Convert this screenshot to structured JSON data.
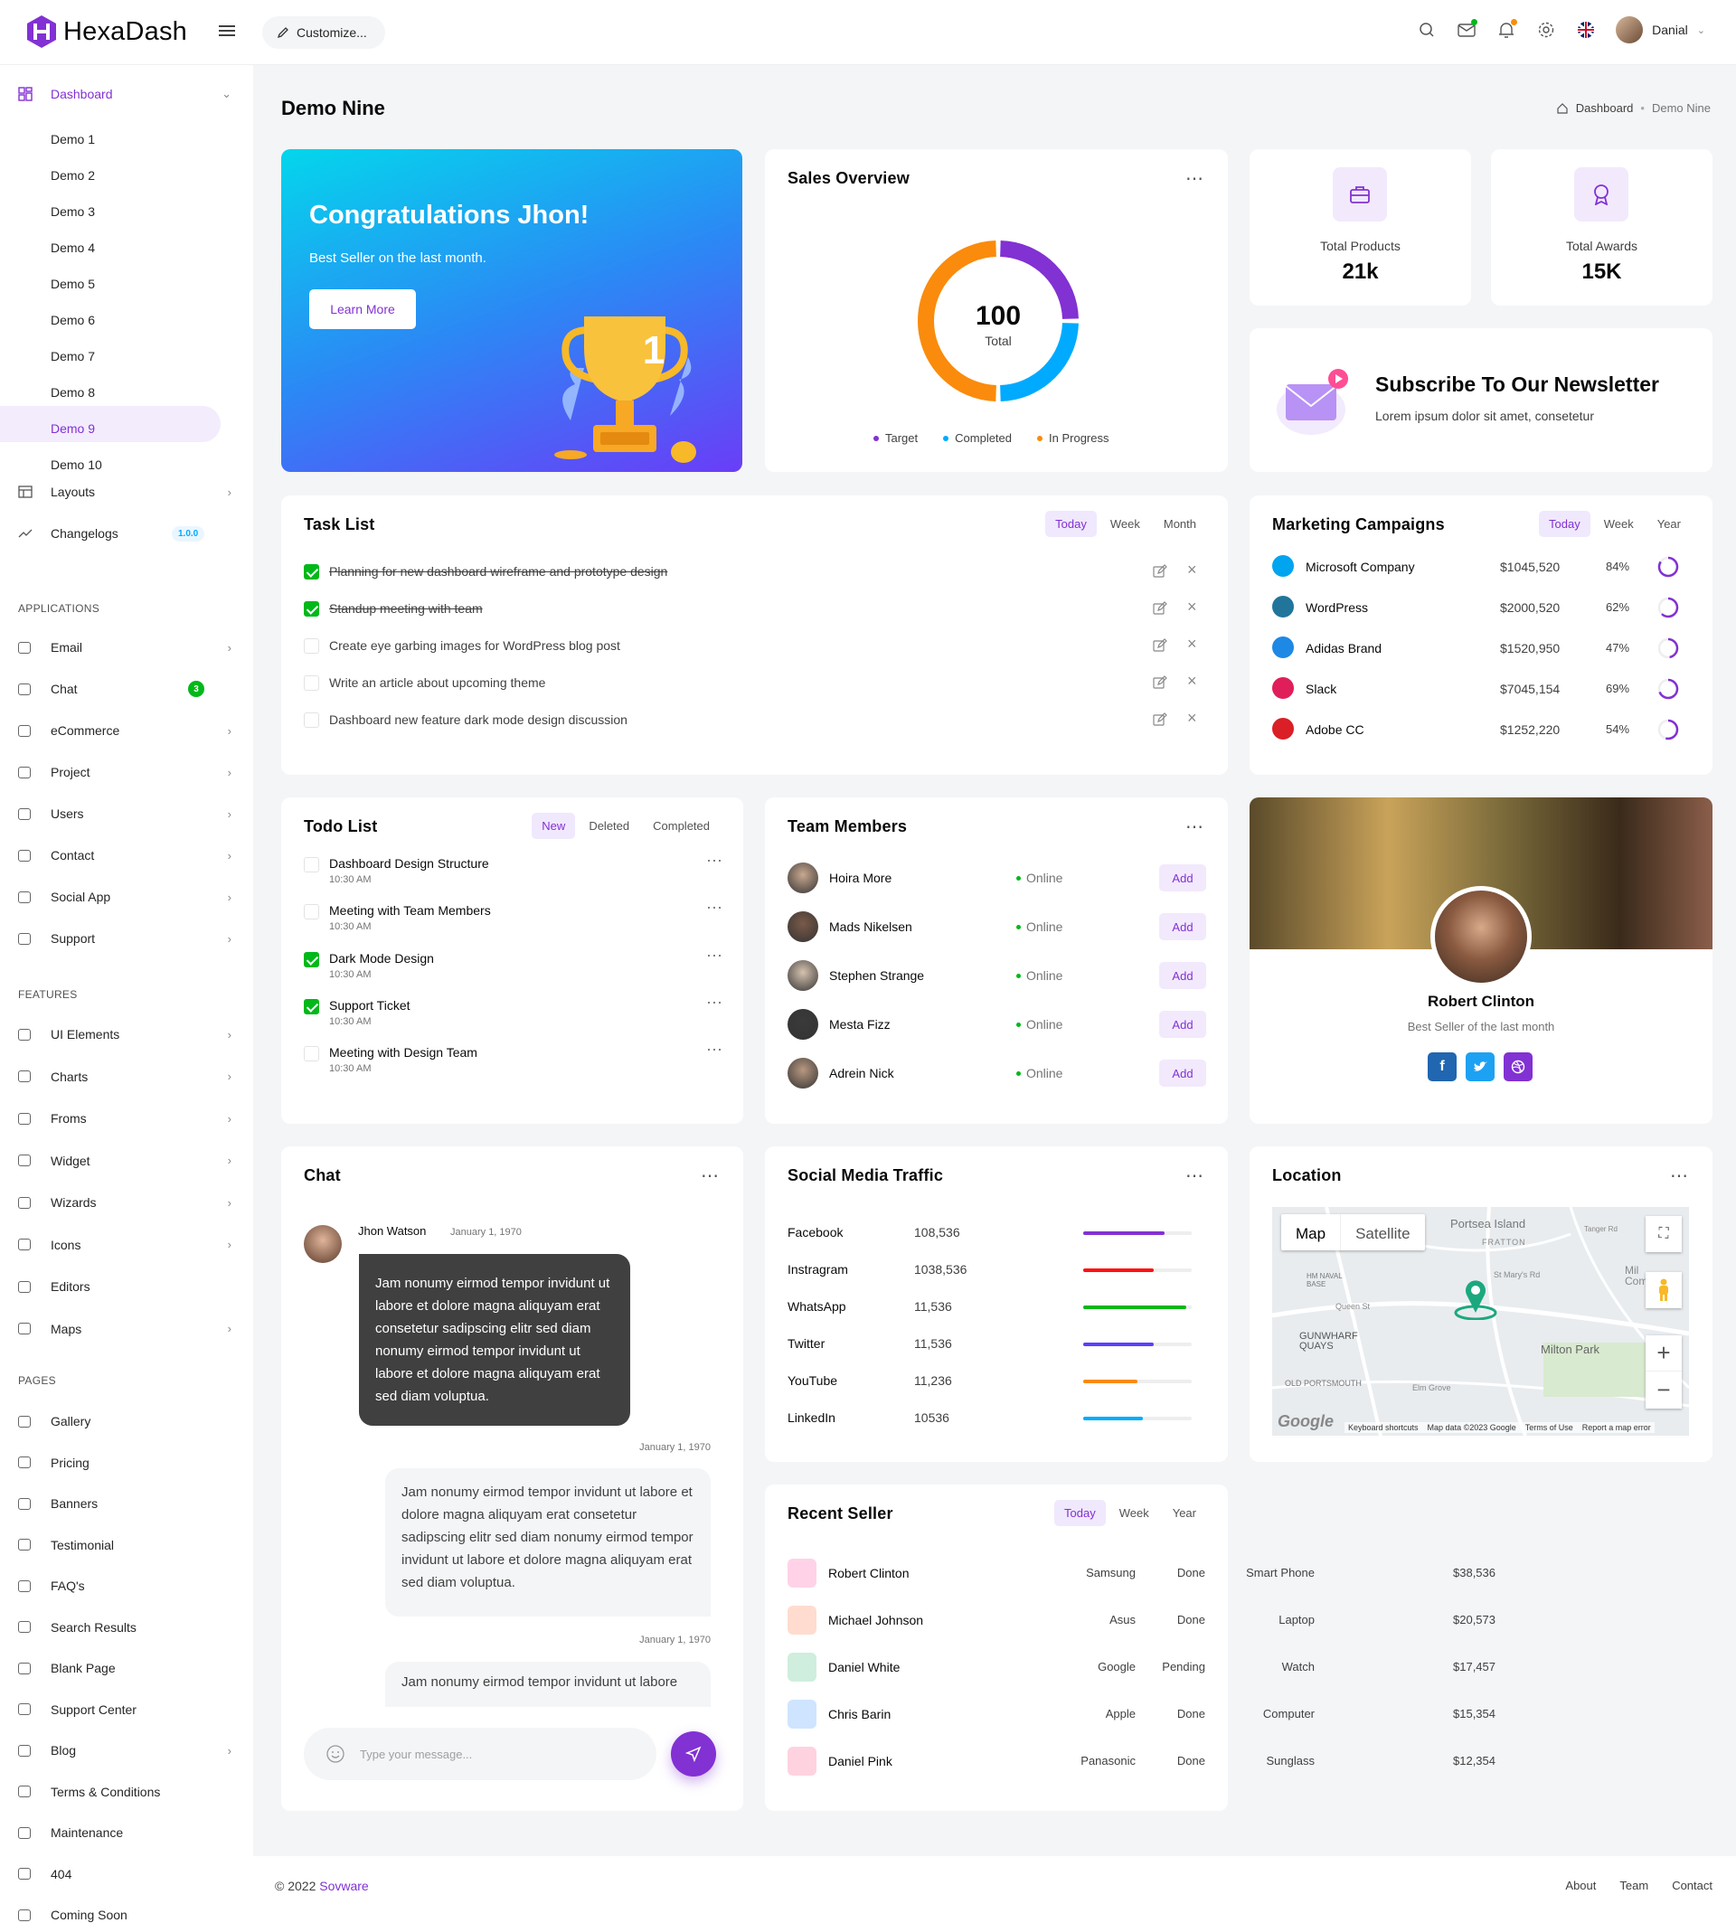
{
  "brand": {
    "name": "HexaDash"
  },
  "header": {
    "customize": "Customize...",
    "user_name": "Danial"
  },
  "sidebar": {
    "dashboard": "Dashboard",
    "demos": [
      "Demo 1",
      "Demo 2",
      "Demo 3",
      "Demo 4",
      "Demo 5",
      "Demo 6",
      "Demo 7",
      "Demo 8",
      "Demo 9",
      "Demo 10"
    ],
    "layouts": "Layouts",
    "changelogs": "Changelogs",
    "changelogs_badge": "1.0.0",
    "applications_title": "APPLICATIONS",
    "applications": [
      "Email",
      "Chat",
      "eCommerce",
      "Project",
      "Users",
      "Contact",
      "Social App",
      "Support"
    ],
    "chat_badge": "3",
    "features_title": "FEATURES",
    "features": [
      "UI Elements",
      "Charts",
      "Froms",
      "Widget",
      "Wizards",
      "Icons",
      "Editors",
      "Maps"
    ],
    "pages_title": "PAGES",
    "pages": [
      "Gallery",
      "Pricing",
      "Banners",
      "Testimonial",
      "FAQ's",
      "Search Results",
      "Blank Page",
      "Support Center",
      "Blog",
      "Terms & Conditions",
      "Maintenance",
      "404",
      "Coming Soon"
    ]
  },
  "page": {
    "title": "Demo Nine",
    "breadcrumb_home": "Dashboard",
    "breadcrumb_current": "Demo Nine"
  },
  "congrats": {
    "title": "Congratulations Jhon!",
    "subtitle": "Best Seller on the last month.",
    "button": "Learn More",
    "trophy_number": "1"
  },
  "sales_overview": {
    "title": "Sales Overview",
    "total_value": "100",
    "total_label": "Total",
    "legend": [
      "Target",
      "Completed",
      "In Progress"
    ]
  },
  "chart_data": {
    "type": "pie",
    "title": "Sales Overview",
    "categories": [
      "Target",
      "Completed",
      "In Progress"
    ],
    "values": [
      25,
      25,
      50
    ],
    "colors": [
      "#8231d3",
      "#00aaff",
      "#fa8b0c"
    ]
  },
  "stats": [
    {
      "label": "Total Products",
      "value": "21k"
    },
    {
      "label": "Total Awards",
      "value": "15K"
    }
  ],
  "newsletter": {
    "title": "Subscribe To Our Newsletter",
    "text": "Lorem ipsum dolor sit amet, consetetur"
  },
  "task_list": {
    "title": "Task List",
    "tabs": [
      "Today",
      "Week",
      "Month"
    ],
    "items": [
      {
        "text": "Planning for new dashboard wireframe and prototype design",
        "done": true
      },
      {
        "text": "Standup meeting with team",
        "done": true
      },
      {
        "text": "Create eye garbing images for WordPress blog post",
        "done": false
      },
      {
        "text": "Write an article about upcoming theme",
        "done": false
      },
      {
        "text": "Dashboard new feature dark mode design discussion",
        "done": false
      }
    ]
  },
  "marketing": {
    "title": "Marketing Campaigns",
    "tabs": [
      "Today",
      "Week",
      "Year"
    ],
    "rows": [
      {
        "name": "Microsoft Company",
        "amount": "$1045,520",
        "percent": "84%",
        "pct": 0.84,
        "color": "#00a4ef"
      },
      {
        "name": "WordPress",
        "amount": "$2000,520",
        "percent": "62%",
        "pct": 0.62,
        "color": "#21759b"
      },
      {
        "name": "Adidas Brand",
        "amount": "$1520,950",
        "percent": "47%",
        "pct": 0.47,
        "color": "#1e88e5"
      },
      {
        "name": "Slack",
        "amount": "$7045,154",
        "percent": "69%",
        "pct": 0.69,
        "color": "#e01e5a"
      },
      {
        "name": "Adobe CC",
        "amount": "$1252,220",
        "percent": "54%",
        "pct": 0.54,
        "color": "#da1f26"
      }
    ]
  },
  "todo": {
    "title": "Todo List",
    "tabs": [
      "New",
      "Deleted",
      "Completed"
    ],
    "items": [
      {
        "title": "Dashboard Design Structure",
        "time": "10:30 AM",
        "done": false
      },
      {
        "title": "Meeting with Team Members",
        "time": "10:30 AM",
        "done": false
      },
      {
        "title": "Dark Mode Design",
        "time": "10:30 AM",
        "done": true
      },
      {
        "title": "Support Ticket",
        "time": "10:30 AM",
        "done": true
      },
      {
        "title": "Meeting with Design Team",
        "time": "10:30 AM",
        "done": false
      }
    ]
  },
  "team": {
    "title": "Team Members",
    "add_label": "Add",
    "members": [
      {
        "name": "Hoira More",
        "status": "Online"
      },
      {
        "name": "Mads Nikelsen",
        "status": "Online"
      },
      {
        "name": "Stephen Strange",
        "status": "Online"
      },
      {
        "name": "Mesta Fizz",
        "status": "Online"
      },
      {
        "name": "Adrein Nick",
        "status": "Online"
      }
    ]
  },
  "profile": {
    "name": "Robert Clinton",
    "subtitle": "Best Seller of the last month"
  },
  "chat": {
    "title": "Chat",
    "sender": "Jhon Watson",
    "date": "January 1, 1970",
    "msg1": "Jam nonumy eirmod tempor invidunt ut labore et dolore magna aliquyam erat consetetur sadipscing elitr sed diam nonumy eirmod tempor invidunt ut labore et dolore magna aliquyam erat sed diam voluptua.",
    "date2": "January 1, 1970",
    "msg2": "Jam nonumy eirmod tempor invidunt ut labore et dolore magna aliquyam erat consetetur sadipscing elitr sed diam nonumy eirmod tempor invidunt ut labore et dolore magna aliquyam erat sed diam voluptua.",
    "date3": "January 1, 1970",
    "msg3": "Jam nonumy eirmod tempor invidunt ut labore",
    "placeholder": "Type your message..."
  },
  "social": {
    "title": "Social Media Traffic",
    "rows": [
      {
        "name": "Facebook",
        "value": "108,536",
        "pct": 0.75,
        "color": "#8231d3"
      },
      {
        "name": "Instragram",
        "value": "1038,536",
        "pct": 0.65,
        "color": "#ff0f0f"
      },
      {
        "name": "WhatsApp",
        "value": "11,536",
        "pct": 0.95,
        "color": "#01b81a"
      },
      {
        "name": "Twitter",
        "value": "11,536",
        "pct": 0.65,
        "color": "#5840ff"
      },
      {
        "name": "YouTube",
        "value": "11,236",
        "pct": 0.5,
        "color": "#fa8b0c"
      },
      {
        "name": "LinkedIn",
        "value": "10536",
        "pct": 0.55,
        "color": "#00aaff"
      }
    ]
  },
  "location": {
    "title": "Location",
    "map_tab": "Map",
    "satellite_tab": "Satellite",
    "labels": [
      "Portsea Island",
      "FRATTON",
      "HM NAVAL BASE",
      "Queen St",
      "GUNWHARF QUAYS",
      "OLD PORTSMOUTH",
      "Milton Park",
      "St Mary's Rd",
      "Elm Grove",
      "Mil Com",
      "Tanger Rd"
    ],
    "footer": [
      "Keyboard shortcuts",
      "Map data ©2023 Google",
      "Terms of Use",
      "Report a map error"
    ],
    "google": "Google"
  },
  "recent_seller": {
    "title": "Recent Seller",
    "tabs": [
      "Today",
      "Week",
      "Year"
    ],
    "rows": [
      {
        "name": "Robert Clinton",
        "brand": "Samsung",
        "product": "Smart Phone",
        "amount": "$38,536",
        "status": "Done"
      },
      {
        "name": "Michael Johnson",
        "brand": "Asus",
        "product": "Laptop",
        "amount": "$20,573",
        "status": "Done"
      },
      {
        "name": "Daniel White",
        "brand": "Google",
        "product": "Watch",
        "amount": "$17,457",
        "status": "Pending"
      },
      {
        "name": "Chris Barin",
        "brand": "Apple",
        "product": "Computer",
        "amount": "$15,354",
        "status": "Done"
      },
      {
        "name": "Daniel Pink",
        "brand": "Panasonic",
        "product": "Sunglass",
        "amount": "$12,354",
        "status": "Done"
      }
    ]
  },
  "footer": {
    "copyright": "© 2022",
    "company": "Sovware",
    "links": [
      "About",
      "Team",
      "Contact"
    ]
  }
}
